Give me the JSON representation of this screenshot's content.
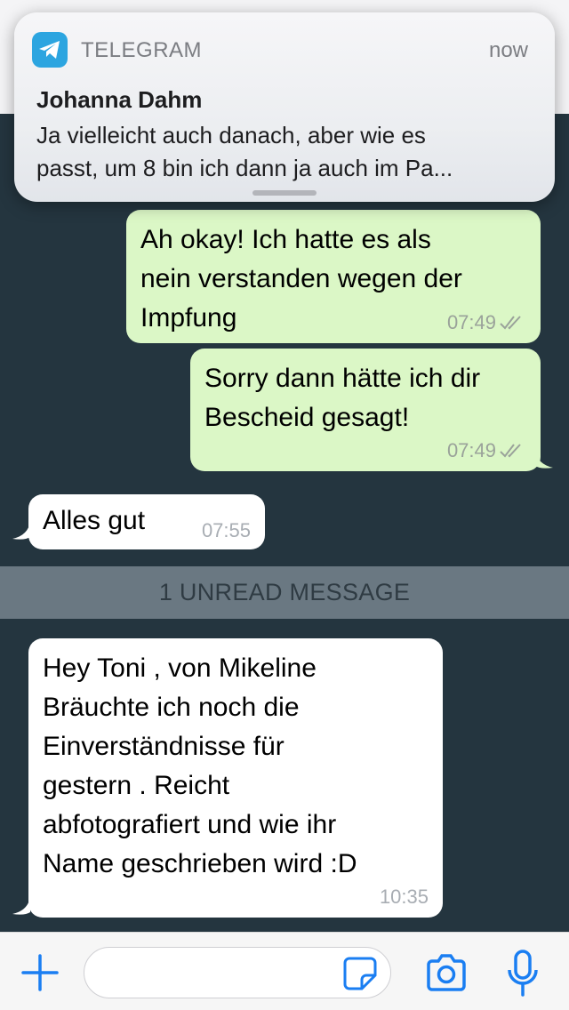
{
  "notification": {
    "app_name": "TELEGRAM",
    "time": "now",
    "sender": "Johanna Dahm",
    "line1": "Ja vielleicht auch danach, aber wie es",
    "line2": "passt, um 8 bin ich dann ja auch im Pa..."
  },
  "messages": [
    {
      "direction": "outgoing",
      "lines": [
        "Ah okay! Ich hatte es als",
        "nein verstanden wegen der",
        "Impfung"
      ],
      "time": "07:49",
      "status_icon": "double-check-icon"
    },
    {
      "direction": "outgoing",
      "lines": [
        "Sorry dann hätte ich dir",
        "Bescheid gesagt!"
      ],
      "time": "07:49",
      "status_icon": "double-check-icon"
    },
    {
      "direction": "incoming",
      "lines": [
        "Alles gut"
      ],
      "time": "07:55"
    },
    {
      "direction": "incoming",
      "lines": [
        "Hey Toni , von Mikeline",
        "Bräuchte ich noch die",
        "Einverständnisse für",
        "gestern . Reicht",
        "abfotografiert und wie ihr",
        "Name geschrieben wird :D"
      ],
      "time": "10:35"
    }
  ],
  "unread_divider": "1 UNREAD MESSAGE",
  "input_bar": {
    "placeholder": "",
    "icons": [
      "plus-icon",
      "sticker-icon",
      "camera-icon",
      "microphone-icon"
    ]
  },
  "colors": {
    "chat_background": "#24353f",
    "outgoing_bubble": "#dbf7c6",
    "incoming_bubble": "#ffffff",
    "accent": "#1a7ef2",
    "telegram_blue": "#2ca5e0"
  }
}
